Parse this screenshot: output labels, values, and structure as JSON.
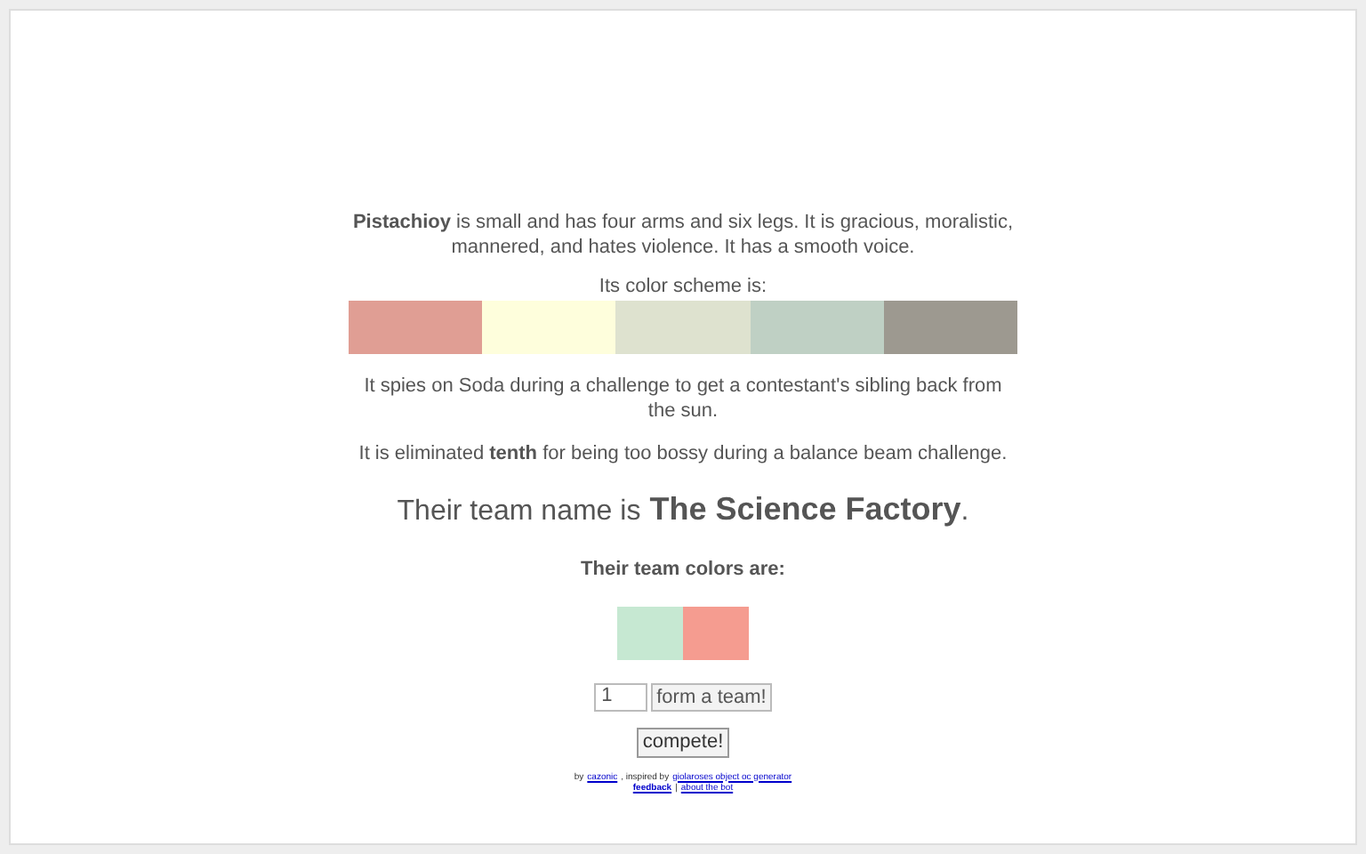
{
  "description": "**Pistachioy** is small and has four arms and six legs. It is gracious, moralistic, mannered, and hates violence. It has a smooth voice.",
  "scheme_label": "Its color scheme is:",
  "scheme": [
    {
      "color": "#e09e94"
    },
    {
      "color": "#fefedc"
    },
    {
      "color": "#dee2cf"
    },
    {
      "color": "#bfd0c4"
    },
    {
      "color": "#9d9990"
    }
  ],
  "story": "It spies on Soda during a challenge to get a contestant's sibling back from the sun.",
  "elimination": "It is eliminated **tenth** for being too bossy during a balance beam challenge.",
  "team_prefix": "Their team name is",
  "team_name": "The Science Factory",
  "team_suffix": ".",
  "team_colors_label": "Their team colors are:",
  "team_colors": [
    {
      "color": "#c6e8d2"
    },
    {
      "color": "#f59c90"
    }
  ],
  "count_value": "1",
  "form_button": "form a team!",
  "compete_button": "compete!",
  "footer": {
    "by": "by",
    "author": "cazonic",
    "inspired": ", inspired by",
    "source": "giolaroses object oc generator",
    "feedback": "feedback",
    "sep": "|",
    "about": "about the bot"
  }
}
